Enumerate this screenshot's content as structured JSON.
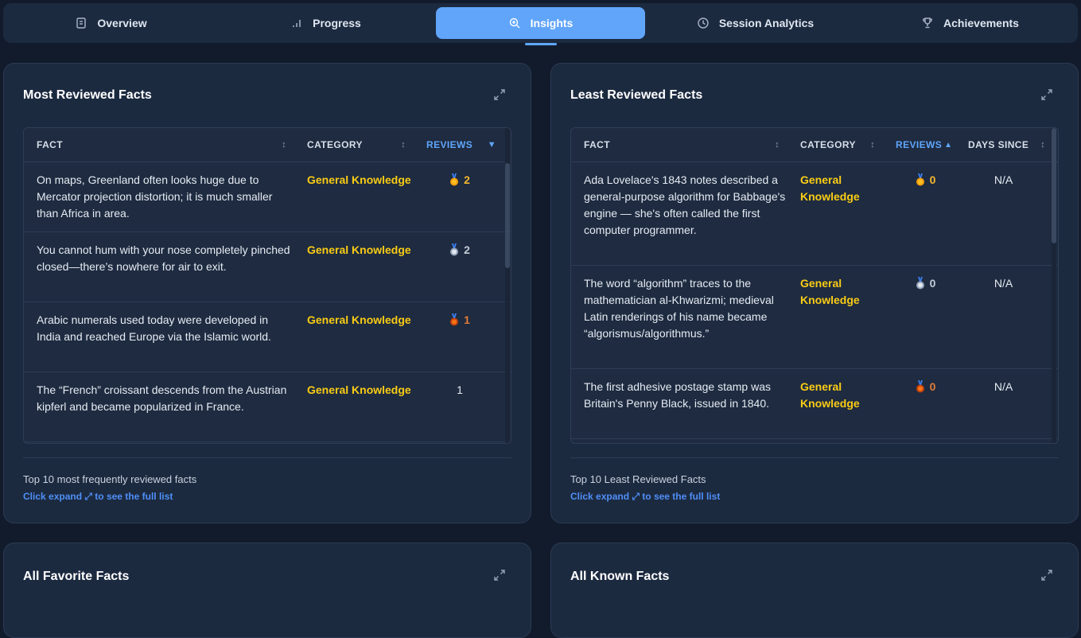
{
  "tabs": [
    {
      "label": "Overview",
      "icon": "document-icon"
    },
    {
      "label": "Progress",
      "icon": "bar-chart-icon"
    },
    {
      "label": "Insights",
      "icon": "zoom-in-icon",
      "active": true
    },
    {
      "label": "Session Analytics",
      "icon": "clock-icon"
    },
    {
      "label": "Achievements",
      "icon": "trophy-icon"
    }
  ],
  "most_reviewed": {
    "title": "Most Reviewed Facts",
    "columns": {
      "fact": "FACT",
      "category": "CATEGORY",
      "reviews": "REVIEWS"
    },
    "rows": [
      {
        "fact": "On maps, Greenland often looks huge due to Mercator projection distortion; it is much smaller than Africa in area.",
        "category": "General Knowledge",
        "reviews": "2",
        "medal": "gold"
      },
      {
        "fact": "You cannot hum with your nose completely pinched closed—there’s nowhere for air to exit.",
        "category": "General Knowledge",
        "reviews": "2",
        "medal": "silver"
      },
      {
        "fact": "Arabic numerals used today were developed in India and reached Europe via the Islamic world.",
        "category": "General Knowledge",
        "reviews": "1",
        "medal": "bronze"
      },
      {
        "fact": "The “French” croissant descends from the Austrian kipferl and became popularized in France.",
        "category": "General Knowledge",
        "reviews": "1",
        "medal": ""
      }
    ],
    "footer": "Top 10 most frequently reviewed facts",
    "link": "Click expand ⤢ to see the full list"
  },
  "least_reviewed": {
    "title": "Least Reviewed Facts",
    "columns": {
      "fact": "FACT",
      "category": "CATEGORY",
      "reviews": "REVIEWS",
      "days_since": "DAYS SINCE"
    },
    "rows": [
      {
        "fact": "Ada Lovelace's 1843 notes described a general-purpose algorithm for Babbage's engine — she's often called the first computer programmer.",
        "category": "General Knowledge",
        "reviews": "0",
        "medal": "gold",
        "days": "N/A"
      },
      {
        "fact": "The word “algorithm” traces to the mathematician al-Khwarizmi; medieval Latin renderings of his name became “algorismus/algorithmus.”",
        "category": "General Knowledge",
        "reviews": "0",
        "medal": "silver",
        "days": "N/A"
      },
      {
        "fact": "The first adhesive postage stamp was Britain's Penny Black, issued in 1840.",
        "category": "General Knowledge",
        "reviews": "0",
        "medal": "bronze",
        "days": "N/A"
      }
    ],
    "footer": "Top 10 Least Reviewed Facts",
    "link": "Click expand ⤢ to see the full list"
  },
  "favorite": {
    "title": "All Favorite Facts"
  },
  "known": {
    "title": "All Known Facts"
  },
  "colors": {
    "accent": "#60a5fa",
    "category": "#facc15",
    "gold": "#f5b731",
    "silver": "#c4ccd8",
    "bronze": "#e07b39"
  }
}
